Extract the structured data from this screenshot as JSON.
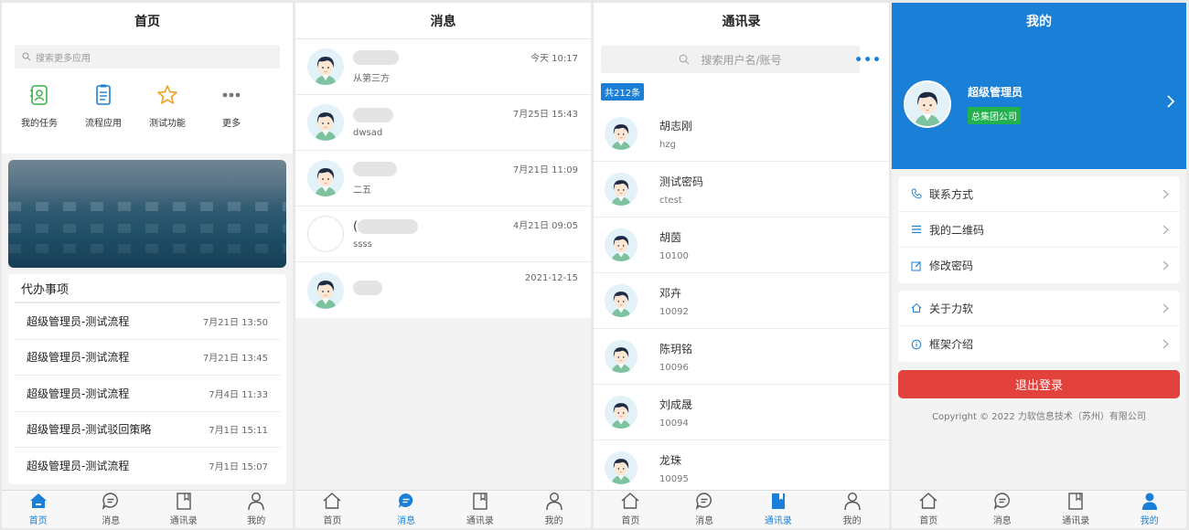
{
  "colors": {
    "accent": "#1a7fd6",
    "logout": "#e2423b",
    "badge": "#21b14d"
  },
  "tabs": [
    {
      "label": "首页",
      "icon": "home-icon"
    },
    {
      "label": "消息",
      "icon": "message-icon"
    },
    {
      "label": "通讯录",
      "icon": "contacts-icon"
    },
    {
      "label": "我的",
      "icon": "user-icon"
    }
  ],
  "home": {
    "title": "首页",
    "search_placeholder": "搜索更多应用",
    "apps": [
      {
        "label": "我的任务",
        "icon": "task-icon"
      },
      {
        "label": "流程应用",
        "icon": "workflow-icon"
      },
      {
        "label": "测试功能",
        "icon": "star-icon"
      },
      {
        "label": "更多",
        "icon": "more-icon"
      }
    ],
    "todo_title": "代办事项",
    "todos": [
      {
        "title": "超级管理员-测试流程",
        "time": "7月21日 13:50"
      },
      {
        "title": "超级管理员-测试流程",
        "time": "7月21日 13:45"
      },
      {
        "title": "超级管理员-测试流程",
        "time": "7月4日 11:33"
      },
      {
        "title": "超级管理员-测试驳回策略",
        "time": "7月1日 15:11"
      },
      {
        "title": "超级管理员-测试流程",
        "time": "7月1日 15:07"
      }
    ]
  },
  "messages": {
    "title": "消息",
    "items": [
      {
        "name": "",
        "preview": "从第三方",
        "time": "今天 10:17"
      },
      {
        "name": "",
        "preview": "dwsad",
        "time": "7月25日 15:43"
      },
      {
        "name": "",
        "preview": "二五",
        "time": "7月21日 11:09"
      },
      {
        "name": "(",
        "preview": "ssss",
        "time": "4月21日 09:05"
      },
      {
        "name": "",
        "preview": "",
        "time": "2021-12-15"
      }
    ]
  },
  "contacts": {
    "title": "通讯录",
    "search_placeholder": "搜索用户名/账号",
    "count": "共212条",
    "items": [
      {
        "name": "胡志刚",
        "account": "hzg"
      },
      {
        "name": "测试密码",
        "account": "ctest"
      },
      {
        "name": "胡茵",
        "account": "10100"
      },
      {
        "name": "邓卉",
        "account": "10092"
      },
      {
        "name": "陈玥铭",
        "account": "10096"
      },
      {
        "name": "刘成晟",
        "account": "10094"
      },
      {
        "name": "龙珠",
        "account": "10095"
      }
    ]
  },
  "mine": {
    "title": "我的",
    "user_name": "超级管理员",
    "company": "总集团公司",
    "group1": [
      {
        "label": "联系方式",
        "icon": "phone-icon"
      },
      {
        "label": "我的二维码",
        "icon": "list-icon"
      },
      {
        "label": "修改密码",
        "icon": "edit-icon"
      }
    ],
    "group2": [
      {
        "label": "关于力软",
        "icon": "home-icon"
      },
      {
        "label": "框架介绍",
        "icon": "info-icon"
      }
    ],
    "logout": "退出登录",
    "copyright": "Copyright © 2022 力软信息技术（苏州）有限公司"
  }
}
